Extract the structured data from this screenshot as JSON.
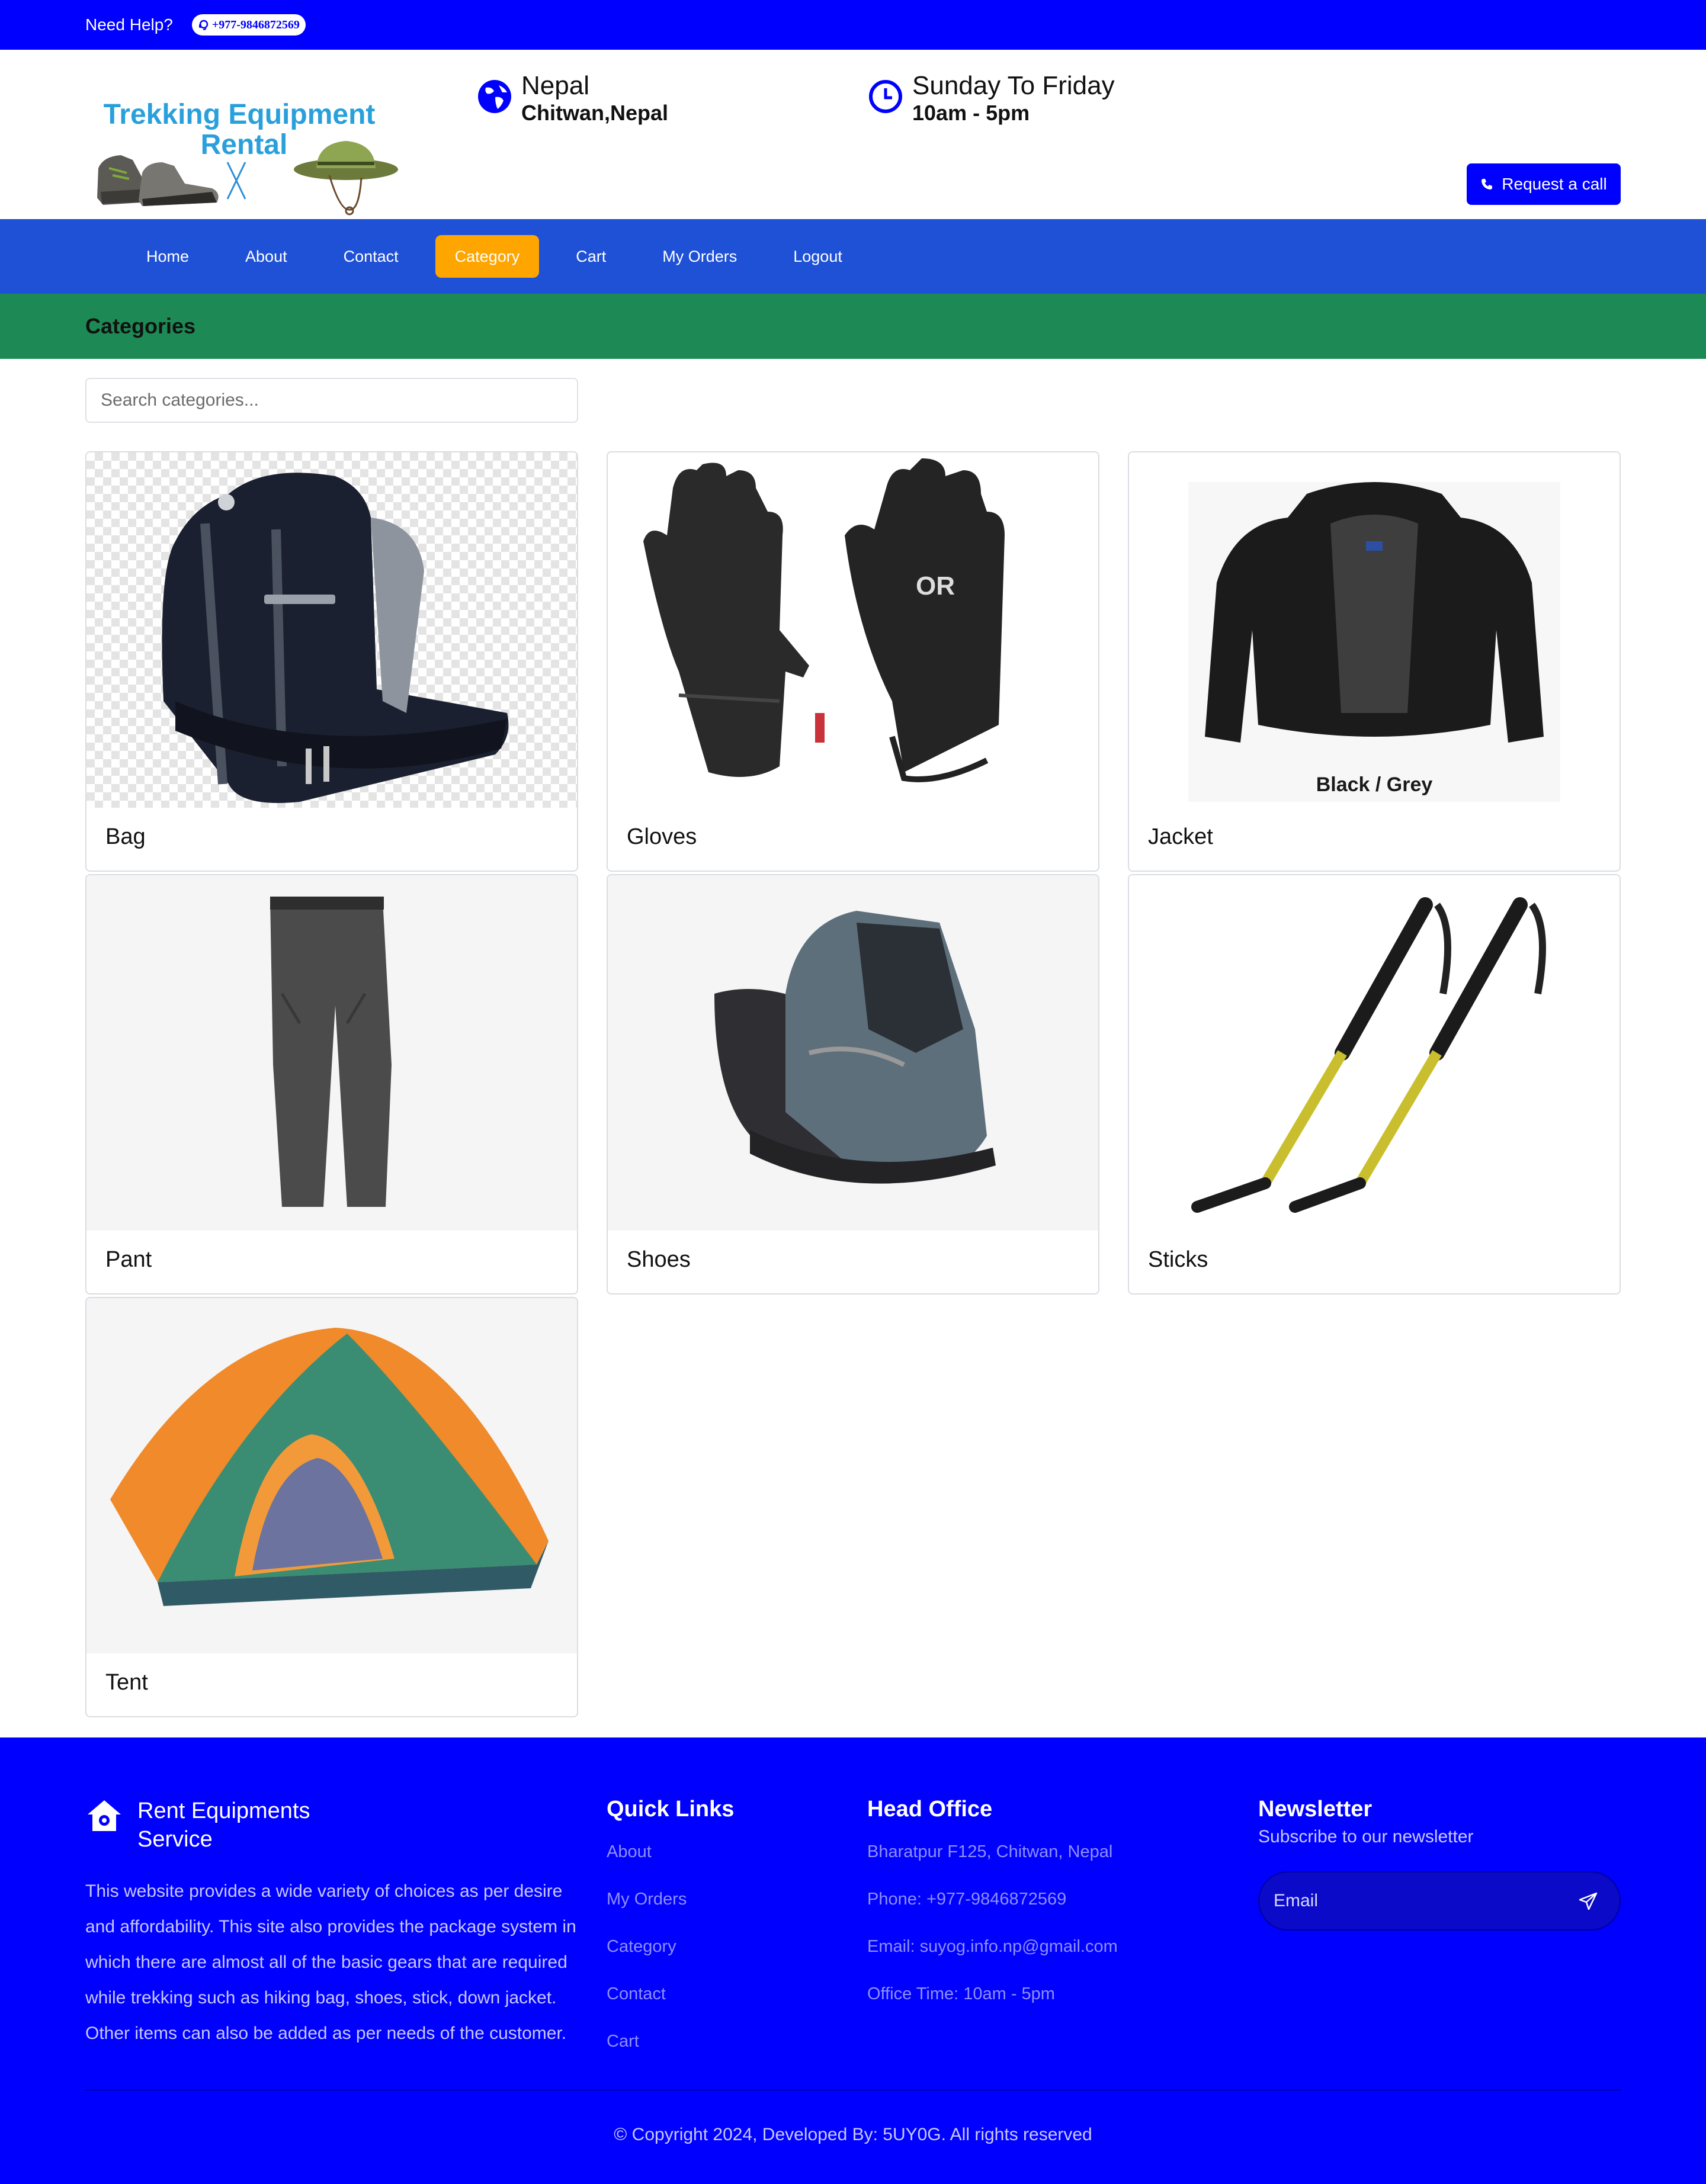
{
  "topbar": {
    "help_label": "Need Help?",
    "phone": "+977-9846872569"
  },
  "header": {
    "logo": {
      "line1": "Trekking Equipment",
      "line2": "Rental"
    },
    "location": {
      "title": "Nepal",
      "subtitle": "Chitwan,Nepal",
      "icon": "globe-icon"
    },
    "hours": {
      "title": "Sunday To Friday",
      "subtitle": "10am - 5pm",
      "icon": "clock-icon"
    },
    "request_call_label": "Request a call"
  },
  "nav": {
    "items": [
      {
        "label": "Home"
      },
      {
        "label": "About"
      },
      {
        "label": "Contact"
      },
      {
        "label": "Category",
        "active": true
      },
      {
        "label": "Cart"
      },
      {
        "label": "My Orders"
      },
      {
        "label": "Logout"
      }
    ]
  },
  "page": {
    "heading": "Categories",
    "search_placeholder": "Search categories..."
  },
  "categories": [
    {
      "name": "Bag"
    },
    {
      "name": "Gloves"
    },
    {
      "name": "Jacket",
      "image_caption": "Black / Grey"
    },
    {
      "name": "Pant"
    },
    {
      "name": "Shoes"
    },
    {
      "name": "Sticks"
    },
    {
      "name": "Tent"
    }
  ],
  "footer": {
    "brand": "Rent Equipments Service",
    "description": "This website provides a wide variety of choices as per desire and affordability. This site also provides the package system in which there are almost all of the basic gears that are required while trekking such as hiking bag, shoes, stick, down jacket. Other items can also be added as per needs of the customer.",
    "quick_links": {
      "title": "Quick Links",
      "items": [
        "About",
        "My Orders",
        "Category",
        "Contact",
        "Cart"
      ]
    },
    "head_office": {
      "title": "Head Office",
      "address": "Bharatpur F125, Chitwan, Nepal",
      "phone": "Phone: +977-9846872569",
      "email": "Email: suyog.info.np@gmail.com",
      "office_time": "Office Time: 10am - 5pm"
    },
    "newsletter": {
      "title": "Newsletter",
      "subtitle": "Subscribe to our newsletter",
      "email_placeholder": "Email"
    },
    "copyright": "© Copyright 2024, Developed By: 5UY0G. All rights reserved"
  },
  "colors": {
    "primary_blue": "#0000ff",
    "nav_blue": "#1f51d6",
    "category_green": "#1d8a55",
    "active_orange": "#ffa500"
  }
}
